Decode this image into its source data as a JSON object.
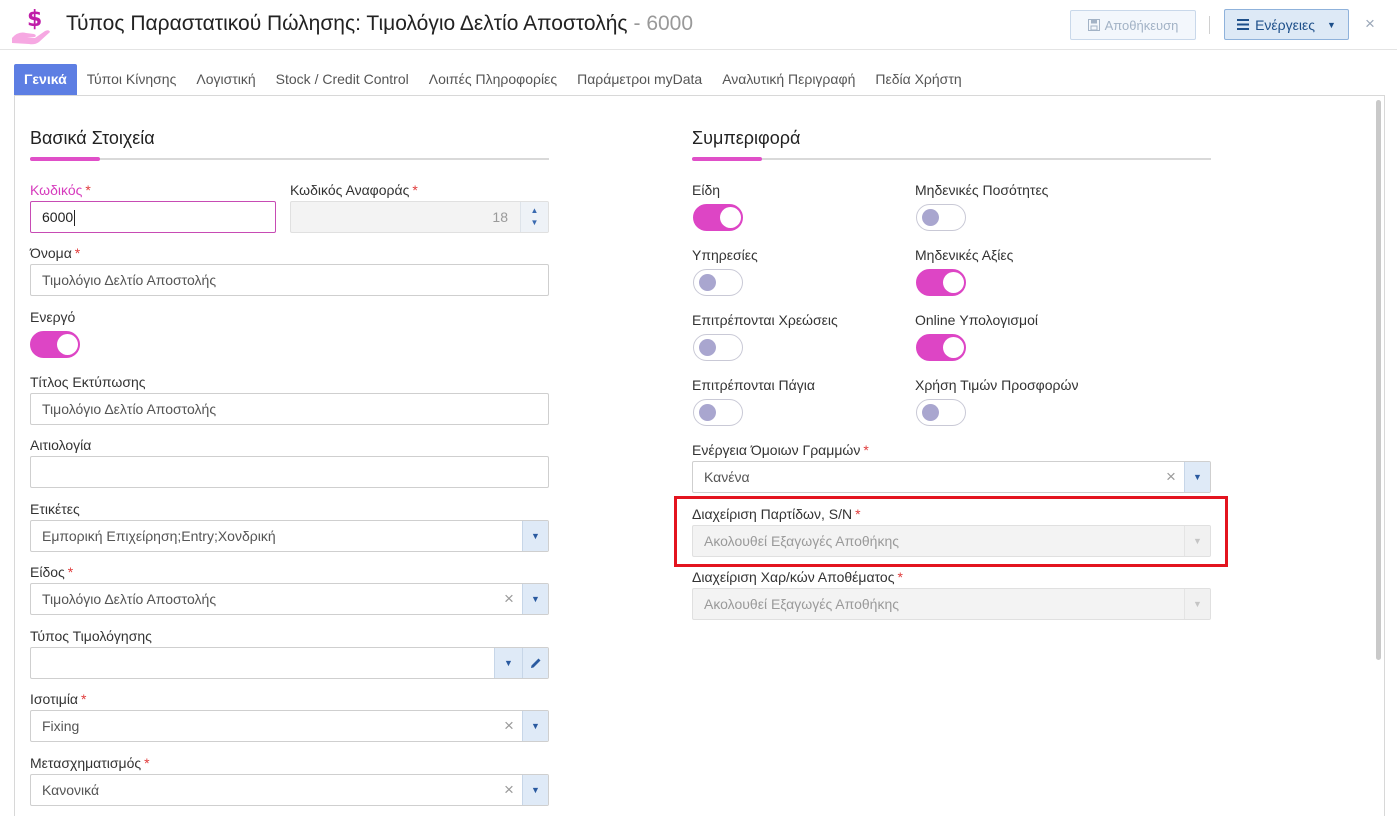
{
  "header": {
    "title": "Τύπος Παραστατικού Πώλησης: Τιμολόγιο Δελτίο Αποστολής",
    "code": "- 6000",
    "save_label": "Αποθήκευση",
    "actions_label": "Ενέργειες",
    "close_symbol": "×",
    "icon": "dollar-hand-icon"
  },
  "tabs": [
    {
      "label": "Γενικά",
      "active": true
    },
    {
      "label": "Τύποι Κίνησης"
    },
    {
      "label": "Λογιστική"
    },
    {
      "label": "Stock / Credit Control"
    },
    {
      "label": "Λοιπές Πληροφορίες"
    },
    {
      "label": "Παράμετροι myData"
    },
    {
      "label": "Αναλυτική Περιγραφή"
    },
    {
      "label": "Πεδία Χρήστη"
    }
  ],
  "basic": {
    "title": "Βασικά Στοιχεία",
    "code": {
      "label": "Κωδικός",
      "value": "6000"
    },
    "ref_code": {
      "label": "Κωδικός Αναφοράς",
      "value": "18"
    },
    "name": {
      "label": "Όνομα",
      "value": "Τιμολόγιο Δελτίο Αποστολής"
    },
    "active": {
      "label": "Ενεργό",
      "on": true
    },
    "print_title": {
      "label": "Τίτλος Εκτύπωσης",
      "value": "Τιμολόγιο Δελτίο Αποστολής"
    },
    "reason": {
      "label": "Αιτιολογία",
      "value": ""
    },
    "tags": {
      "label": "Ετικέτες",
      "value": "Εμπορική Επιχείρηση;Entry;Χονδρική"
    },
    "kind": {
      "label": "Είδος",
      "value": "Τιμολόγιο Δελτίο Αποστολής"
    },
    "billing_type": {
      "label": "Τύπος Τιμολόγησης",
      "value": ""
    },
    "parity": {
      "label": "Ισοτιμία",
      "value": "Fixing"
    },
    "transform": {
      "label": "Μετασχηματισμός",
      "value": "Κανονικά"
    }
  },
  "behavior": {
    "title": "Συμπεριφορά",
    "items": {
      "label": "Είδη",
      "on": true
    },
    "zero_qty": {
      "label": "Μηδενικές Ποσότητες",
      "on": false
    },
    "services": {
      "label": "Υπηρεσίες",
      "on": false
    },
    "zero_values": {
      "label": "Μηδενικές Αξίες",
      "on": true
    },
    "charges": {
      "label": "Επιτρέπονται Χρεώσεις",
      "on": false
    },
    "online_calc": {
      "label": "Online Υπολογισμοί",
      "on": true
    },
    "fixed_assets": {
      "label": "Επιτρέπονται Πάγια",
      "on": false
    },
    "offer_prices": {
      "label": "Χρήση Τιμών Προσφορών",
      "on": false
    },
    "similar_lines": {
      "label": "Ενέργεια Όμοιων Γραμμών",
      "value": "Κανένα"
    },
    "batches": {
      "label": "Διαχείριση Παρτίδων, S/N",
      "value": "Ακολουθεί Εξαγωγές Αποθήκης"
    },
    "stock_chars": {
      "label": "Διαχείριση Χαρ/κών Αποθέματος",
      "value": "Ακολουθεί Εξαγωγές Αποθήκης"
    }
  },
  "symbols": {
    "required": "*",
    "clear": "×",
    "down": "▼",
    "up": "▲"
  }
}
